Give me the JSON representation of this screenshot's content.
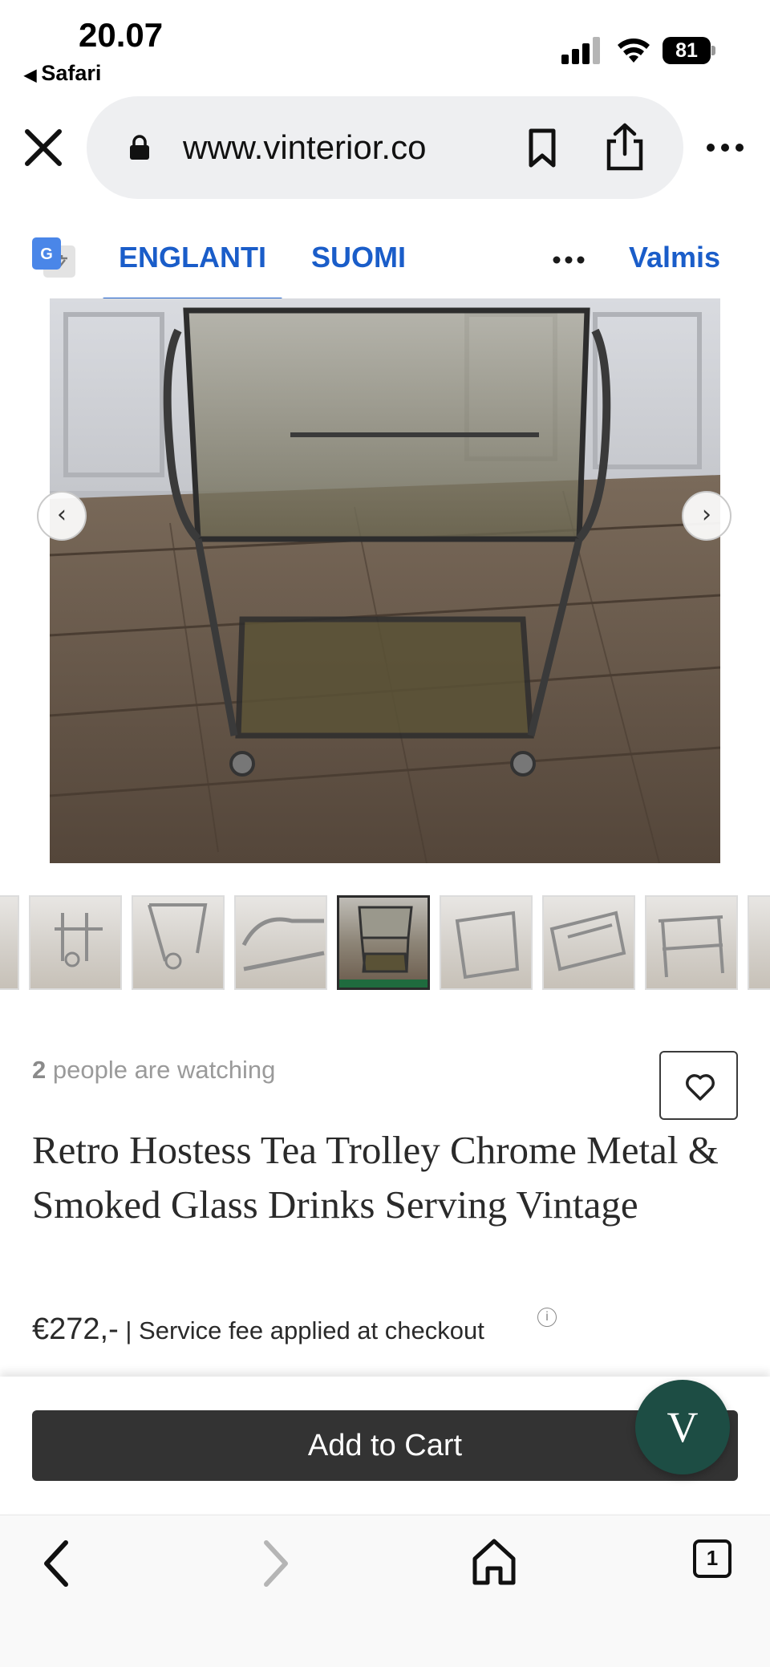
{
  "status_bar": {
    "time": "20.07",
    "back_app": "Safari",
    "battery": "81"
  },
  "browser": {
    "url": "www.vinterior.co"
  },
  "translate_bar": {
    "tab_source": "ENGLANTI",
    "tab_target": "SUOMI",
    "done_label": "Valmis"
  },
  "gallery": {
    "prev_label": "‹",
    "next_label": "›",
    "selected_index": 4,
    "thumbnail_count": 8
  },
  "product": {
    "watching_count": "2",
    "watching_text": " people are watching",
    "title": "Retro Hostess Tea Trolley Chrome Metal & Smoked Glass Drinks Serving Vintage",
    "price": "€272,-",
    "fee_text": " | Service fee applied at checkout",
    "info_symbol": "i"
  },
  "actions": {
    "add_to_cart": "Add to Cart",
    "chat_badge": "V"
  },
  "toolbar": {
    "tabs_count": "1"
  },
  "colors": {
    "accent_blue": "#1a5dc9",
    "cart_button": "#333333",
    "chat_badge": "#1d4d44",
    "selected_thumb_bar": "#1f6b3e"
  }
}
